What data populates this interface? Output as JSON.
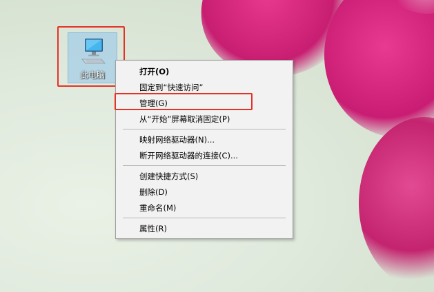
{
  "desktop": {
    "icon_label": "此电脑"
  },
  "context_menu": {
    "items": [
      {
        "label": "打开(O)"
      },
      {
        "label": "固定到“快速访问”"
      },
      {
        "label": "管理(G)"
      },
      {
        "label": "从“开始”屏幕取消固定(P)"
      },
      {
        "label": "映射网络驱动器(N)..."
      },
      {
        "label": "断开网络驱动器的连接(C)..."
      },
      {
        "label": "创建快捷方式(S)"
      },
      {
        "label": "删除(D)"
      },
      {
        "label": "重命名(M)"
      },
      {
        "label": "属性(R)"
      }
    ]
  },
  "colors": {
    "highlight": "#e53225",
    "selection": "#92c5eb",
    "wallpaper_flower": "#d42a80"
  },
  "icons": [
    "computer-monitor-icon"
  ]
}
